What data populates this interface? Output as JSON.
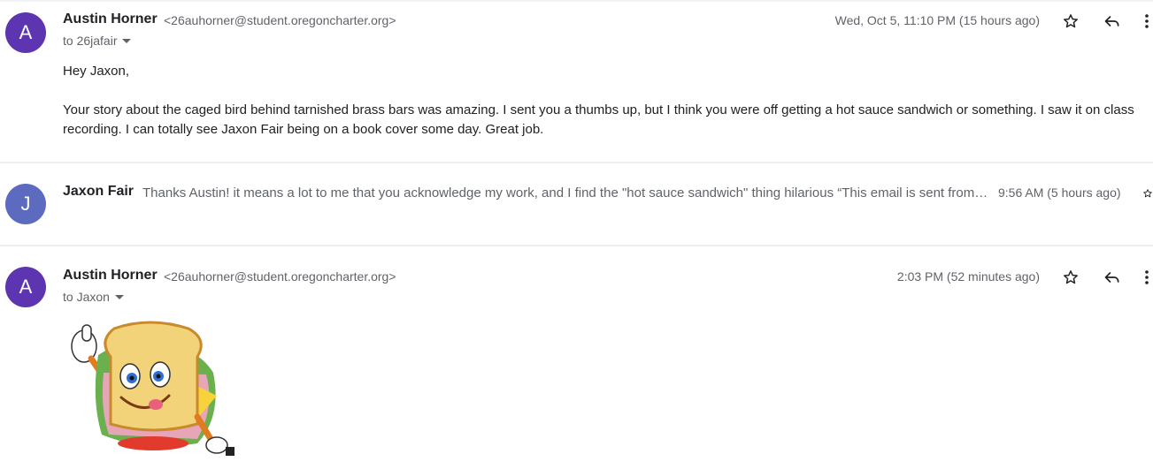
{
  "messages": [
    {
      "avatar_letter": "A",
      "avatar_color": "#5e35b1",
      "sender": "Austin Horner",
      "email": "<26auhorner@student.oregoncharter.org>",
      "to": "to 26jafair",
      "time": "Wed, Oct 5, 11:10 PM (15 hours ago)",
      "greeting": "Hey Jaxon,",
      "body": "Your story about the caged bird behind tarnished brass bars was amazing. I sent you a thumbs up, but I think you were off getting a hot sauce sandwich or something. I saw it on class recording. I can totally see Jaxon Fair being on a book cover some day. Great job."
    },
    {
      "avatar_letter": "J",
      "avatar_color": "#5c6bc0",
      "sender": "Jaxon Fair",
      "snippet": "Thanks Austin! it means a lot to me that you acknowledge my work, and I find the \"hot sauce sandwich\" thing hilarious “This email is sent from…",
      "time": "9:56 AM (5 hours ago)"
    },
    {
      "avatar_letter": "A",
      "avatar_color": "#5e35b1",
      "sender": "Austin Horner",
      "email": "<26auhorner@student.oregoncharter.org>",
      "to": "to Jaxon",
      "time": "2:03 PM (52 minutes ago)"
    }
  ],
  "icons": [
    "star-icon",
    "reply-icon",
    "more-icon",
    "chevron-down-icon"
  ]
}
